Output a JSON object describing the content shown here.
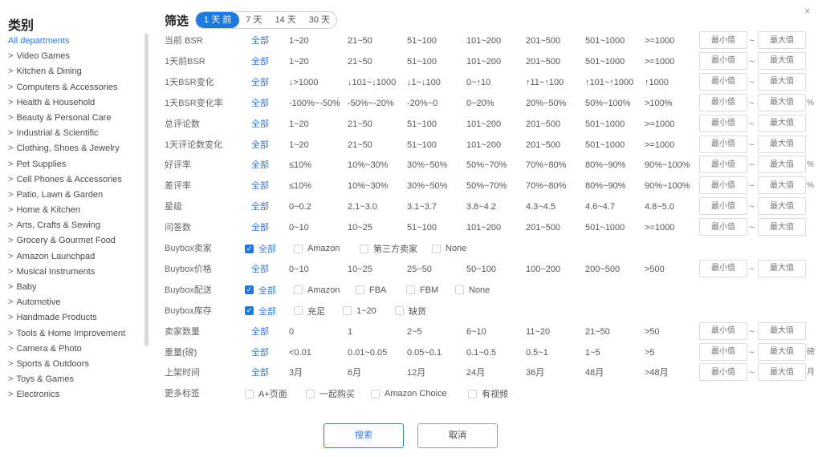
{
  "sidebar": {
    "title": "类别",
    "items": [
      {
        "prefix": "",
        "label": "All departments"
      },
      {
        "prefix": ">",
        "label": "Video Games"
      },
      {
        "prefix": ">",
        "label": "Kitchen & Dining"
      },
      {
        "prefix": ">",
        "label": "Computers & Accessories"
      },
      {
        "prefix": ">",
        "label": "Health & Household"
      },
      {
        "prefix": ">",
        "label": "Beauty & Personal Care"
      },
      {
        "prefix": ">",
        "label": "Industrial & Scientific"
      },
      {
        "prefix": ">",
        "label": "Clothing, Shoes & Jewelry"
      },
      {
        "prefix": ">",
        "label": "Pet Supplies"
      },
      {
        "prefix": ">",
        "label": "Cell Phones & Accessories"
      },
      {
        "prefix": ">",
        "label": "Patio, Lawn & Garden"
      },
      {
        "prefix": ">",
        "label": "Home & Kitchen"
      },
      {
        "prefix": ">",
        "label": "Arts, Crafts & Sewing"
      },
      {
        "prefix": ">",
        "label": "Grocery & Gourmet Food"
      },
      {
        "prefix": ">",
        "label": "Amazon Launchpad"
      },
      {
        "prefix": ">",
        "label": "Musical Instruments"
      },
      {
        "prefix": ">",
        "label": "Baby"
      },
      {
        "prefix": ">",
        "label": "Automotive"
      },
      {
        "prefix": ">",
        "label": "Handmade Products"
      },
      {
        "prefix": ">",
        "label": "Tools & Home Improvement"
      },
      {
        "prefix": ">",
        "label": "Camera & Photo"
      },
      {
        "prefix": ">",
        "label": "Sports & Outdoors"
      },
      {
        "prefix": ">",
        "label": "Toys & Games"
      },
      {
        "prefix": ">",
        "label": "Electronics"
      }
    ]
  },
  "close_icon": "×",
  "filter": {
    "title": "筛选",
    "tabs": [
      "1 天 前",
      "7 天",
      "14 天",
      "30 天"
    ],
    "min_placeholder": "最小值",
    "max_placeholder": "最大值",
    "tilde": "~",
    "rows": [
      {
        "label": "当前 BSR",
        "type": "opts",
        "options": [
          "全部",
          "1~20",
          "21~50",
          "51~100",
          "101~200",
          "201~500",
          "501~1000",
          ">=1000"
        ],
        "range": true,
        "unit": ""
      },
      {
        "label": "1天前BSR",
        "type": "opts",
        "options": [
          "全部",
          "1~20",
          "21~50",
          "51~100",
          "101~200",
          "201~500",
          "501~1000",
          ">=1000"
        ],
        "range": true,
        "unit": ""
      },
      {
        "label": "1天BSR变化",
        "type": "opts",
        "options": [
          "全部",
          "↓>1000",
          "↓101~↓1000",
          "↓1~↓100",
          "0~↑10",
          "↑11~↑100",
          "↑101~↑1000",
          "↑1000"
        ],
        "range": true,
        "unit": ""
      },
      {
        "label": "1天BSR变化率",
        "type": "opts",
        "options": [
          "全部",
          "-100%~-50%",
          "-50%~-20%",
          "-20%~0",
          "0~20%",
          "20%~50%",
          "50%~100%",
          ">100%"
        ],
        "range": true,
        "unit": "%"
      },
      {
        "label": "总评论数",
        "type": "opts",
        "options": [
          "全部",
          "1~20",
          "21~50",
          "51~100",
          "101~200",
          "201~500",
          "501~1000",
          ">=1000"
        ],
        "range": true,
        "unit": ""
      },
      {
        "label": "1天评论数变化",
        "type": "opts",
        "options": [
          "全部",
          "1~20",
          "21~50",
          "51~100",
          "101~200",
          "201~500",
          "501~1000",
          ">=1000"
        ],
        "range": true,
        "unit": ""
      },
      {
        "label": "好评率",
        "type": "opts",
        "options": [
          "全部",
          "≤10%",
          "10%~30%",
          "30%~50%",
          "50%~70%",
          "70%~80%",
          "80%~90%",
          "90%~100%"
        ],
        "range": true,
        "unit": "%"
      },
      {
        "label": "差评率",
        "type": "opts",
        "options": [
          "全部",
          "≤10%",
          "10%~30%",
          "30%~50%",
          "50%~70%",
          "70%~80%",
          "80%~90%",
          "90%~100%"
        ],
        "range": true,
        "unit": "%"
      },
      {
        "label": "星级",
        "type": "opts",
        "options": [
          "全部",
          "0~0.2",
          "2.1~3.0",
          "3.1~3.7",
          "3.8~4.2",
          "4.3~4.5",
          "4.6~4.7",
          "4.8~5.0"
        ],
        "range": true,
        "unit": ""
      },
      {
        "label": "问答数",
        "type": "opts",
        "options": [
          "全部",
          "0~10",
          "10~25",
          "51~100",
          "101~200",
          "201~500",
          "501~1000",
          ">=1000"
        ],
        "range": true,
        "unit": ""
      },
      {
        "label": "Buybox卖家",
        "type": "checks",
        "checks": [
          {
            "text": "全部",
            "on": true
          },
          {
            "text": "Amazon",
            "on": false
          },
          {
            "text": "第三方卖家",
            "on": false
          },
          {
            "text": "None",
            "on": false
          }
        ],
        "range": false,
        "unit": ""
      },
      {
        "label": "Buybox价格",
        "type": "opts",
        "options": [
          "全部",
          "0~10",
          "10~25",
          "25~50",
          "50~100",
          "100~200",
          "200~500",
          ">500"
        ],
        "range": true,
        "unit": ""
      },
      {
        "label": "Buybox配送",
        "type": "checks",
        "checks": [
          {
            "text": "全部",
            "on": true
          },
          {
            "text": "Amazon",
            "on": false
          },
          {
            "text": "FBA",
            "on": false
          },
          {
            "text": "FBM",
            "on": false
          },
          {
            "text": "None",
            "on": false
          }
        ],
        "range": false,
        "unit": ""
      },
      {
        "label": "Buybox库存",
        "type": "checks",
        "checks": [
          {
            "text": "全部",
            "on": true
          },
          {
            "text": "充足",
            "on": false
          },
          {
            "text": "1~20",
            "on": false
          },
          {
            "text": "缺货",
            "on": false
          }
        ],
        "range": false,
        "unit": ""
      },
      {
        "label": "卖家数量",
        "type": "opts",
        "options": [
          "全部",
          "0",
          "1",
          "2~5",
          "6~10",
          "11~20",
          "21~50",
          ">50"
        ],
        "range": true,
        "unit": ""
      },
      {
        "label": "重量(磅)",
        "type": "opts",
        "options": [
          "全部",
          "<0.01",
          "0.01~0.05",
          "0.05~0.1",
          "0.1~0.5",
          "0.5~1",
          "1~5",
          ">5"
        ],
        "range": true,
        "unit": "磅"
      },
      {
        "label": "上架时间",
        "type": "opts",
        "options": [
          "全部",
          "3月",
          "6月",
          "12月",
          "24月",
          "36月",
          "48月",
          ">48月"
        ],
        "range": true,
        "unit": "月"
      },
      {
        "label": "更多标签",
        "type": "checks",
        "checks": [
          {
            "text": "A+页面",
            "on": false
          },
          {
            "text": "一起购买",
            "on": false
          },
          {
            "text": "Amazon Choice",
            "on": false
          },
          {
            "text": "有视频",
            "on": false
          }
        ],
        "range": false,
        "unit": ""
      }
    ]
  },
  "buttons": {
    "search": "搜索",
    "cancel": "取消"
  }
}
